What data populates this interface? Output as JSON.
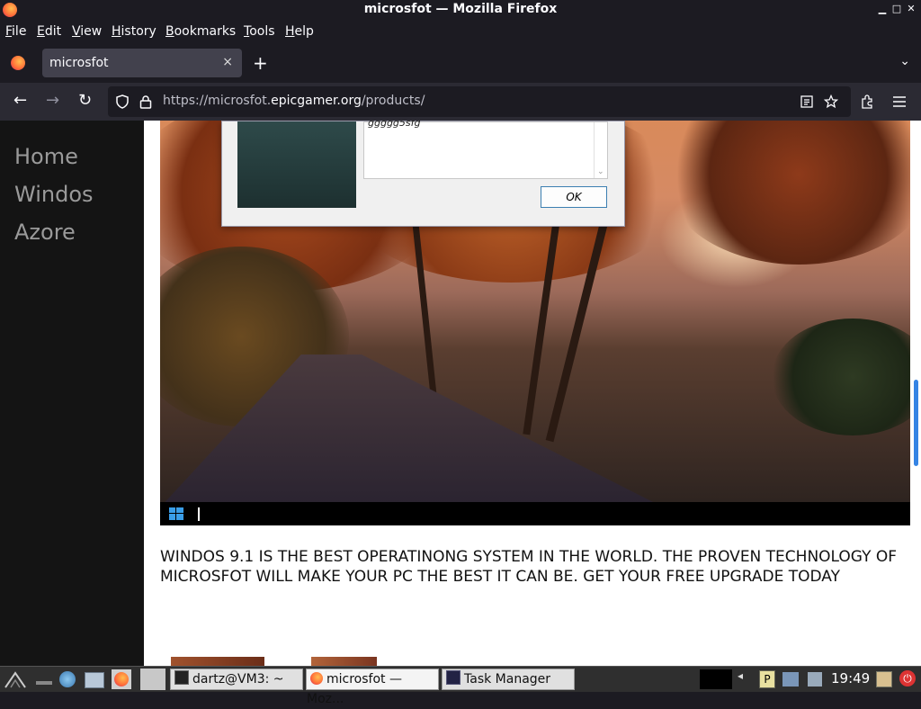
{
  "window": {
    "title": "microsfot — Mozilla Firefox"
  },
  "menu": [
    {
      "label": "File",
      "key": "F",
      "rest": "ile"
    },
    {
      "label": "Edit",
      "key": "E",
      "rest": "dit"
    },
    {
      "label": "View",
      "key": "V",
      "rest": "iew"
    },
    {
      "label": "History",
      "key": "H",
      "rest": "istory"
    },
    {
      "label": "Bookmarks",
      "key": "B",
      "rest": "ookmarks"
    },
    {
      "label": "Tools",
      "key": "T",
      "rest": "ools"
    },
    {
      "label": "Help",
      "key": "H",
      "rest": "elp"
    }
  ],
  "tab": {
    "label": "microsfot",
    "close": "×"
  },
  "toolbar": {
    "new_tab": "+",
    "tabs_menu": "⌄",
    "back": "←",
    "forward": "→",
    "reload": "↻",
    "url_prefix": "https://microsfot.",
    "url_domain": "epicgamer.org",
    "url_path": "/products/"
  },
  "sidebar": {
    "links": [
      "Home",
      "Windos",
      "Azore"
    ]
  },
  "dialog": {
    "text": "ggggg5sfg",
    "ok_label": "OK"
  },
  "main": {
    "tagline": "WINDOS 9.1 IS THE BEST OPERATINONG SYSTEM IN THE WORLD. THE PROVEN TECHNOLOGY OF MICROSFOT WILL MAKE YOUR PC THE BEST IT CAN BE. GET YOUR FREE UPGRADE TODAY"
  },
  "taskbar": {
    "items": [
      {
        "label": "dartz@VM3: ~",
        "icon": "terminal-icon"
      },
      {
        "label": "microsfot — Moz...",
        "icon": "firefox-icon"
      },
      {
        "label": "Task Manager",
        "icon": "task-manager-icon"
      }
    ],
    "clock": "19:49"
  },
  "colors": {
    "chrome_dark": "#1c1b22",
    "navbar": "#2b2a33",
    "tab_active": "#42414d",
    "scroll_accent": "#3584e4"
  }
}
